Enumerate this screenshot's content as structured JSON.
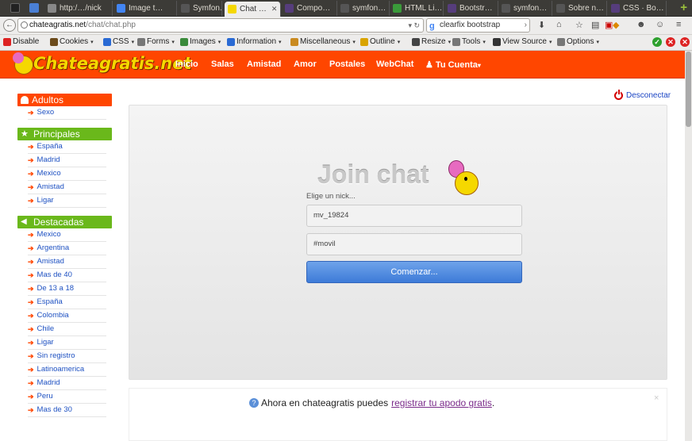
{
  "browser": {
    "tabs": [
      {
        "label": "http:/…/nick",
        "icon": "page-icon",
        "color": "#888"
      },
      {
        "label": "Image t…",
        "icon": "google-icon",
        "color": "#4285f4"
      },
      {
        "label": "Symfon…",
        "icon": "symfony-icon",
        "color": "#555"
      },
      {
        "label": "Chat …",
        "icon": "chateagratis-icon",
        "color": "#f5d800",
        "active": true
      },
      {
        "label": "Compo…",
        "icon": "bootstrap-icon",
        "color": "#563d7c"
      },
      {
        "label": "symfon…",
        "icon": "symfony-icon",
        "color": "#555"
      },
      {
        "label": "HTML Li…",
        "icon": "html-icon",
        "color": "#3a9a3a"
      },
      {
        "label": "Bootstr…",
        "icon": "bootstrap-icon",
        "color": "#563d7c"
      },
      {
        "label": "symfon…",
        "icon": "symfony-icon",
        "color": "#555"
      },
      {
        "label": "Sobre n…",
        "icon": "symfony-icon",
        "color": "#555"
      },
      {
        "label": "CSS · Bo…",
        "icon": "bootstrap-icon",
        "color": "#563d7c"
      }
    ],
    "url_domain": "chateagratis.net",
    "url_path": "/chat/chat.php",
    "search_text": "clearfix bootstrap"
  },
  "webdev": {
    "items": [
      "Disable",
      "Cookies",
      "CSS",
      "Forms",
      "Images",
      "Information",
      "Miscellaneous",
      "Outline",
      "Resize",
      "Tools",
      "View Source",
      "Options"
    ]
  },
  "site": {
    "logo_text": "Chateagratis.net",
    "nav": [
      "Inicio",
      "Salas",
      "Amistad",
      "Amor",
      "Postales",
      "WebChat",
      "Tu Cuenta"
    ]
  },
  "sidebar": {
    "adultos": {
      "title": "Adultos",
      "items": [
        "Sexo"
      ]
    },
    "principales": {
      "title": "Principales",
      "items": [
        "España",
        "Madrid",
        "Mexico",
        "Amistad",
        "Ligar"
      ]
    },
    "destacadas": {
      "title": "Destacadas",
      "items": [
        "Mexico",
        "Argentina",
        "Amistad",
        "Mas de 40",
        "De 13 a 18",
        "España",
        "Colombia",
        "Chile",
        "Ligar",
        "Sin registro",
        "Latinoamerica",
        "Madrid",
        "Peru",
        "Mas de 30"
      ]
    }
  },
  "main": {
    "disconnect": "Desconectar",
    "join_title": "Join chat",
    "nick_label": "Elige un nick...",
    "nick_value": "mv_19824",
    "room_value": "#movil",
    "start_button": "Comenzar..."
  },
  "promo": {
    "text": "Ahora en chateagratis puedes",
    "link": "registrar tu apodo gratis",
    "suffix": ".",
    "close": "×"
  },
  "colors": {
    "brand_orange": "#ff4600",
    "sidebar_green": "#6ab81b",
    "link_blue": "#1e51c2",
    "button_blue": "#4a86dd"
  }
}
